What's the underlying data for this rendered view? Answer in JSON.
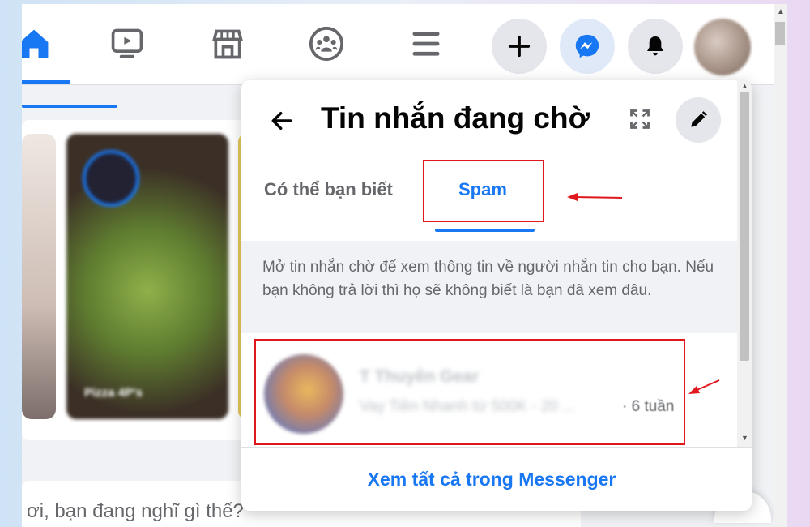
{
  "topbar": {
    "nav": [
      {
        "name": "home-icon",
        "active": true
      },
      {
        "name": "watch-icon"
      },
      {
        "name": "marketplace-icon"
      },
      {
        "name": "groups-icon"
      },
      {
        "name": "menu-icon"
      }
    ],
    "actions": [
      "create-icon",
      "messenger-icon",
      "notifications-icon",
      "profile-avatar"
    ]
  },
  "feed": {
    "story_caption": "Pizza 4P's",
    "composer_placeholder": "ơi, bạn đang nghĩ gì thế?"
  },
  "panel": {
    "title": "Tin nhắn đang chờ",
    "tabs": [
      {
        "label": "Có thể bạn biết",
        "active": false
      },
      {
        "label": "Spam",
        "active": true
      }
    ],
    "info_text": "Mở tin nhắn chờ để xem thông tin về người nhắn tin cho bạn. Nếu bạn không trả lời thì họ sẽ không biết là bạn đã xem đâu.",
    "message": {
      "name": "T Thuyên Gear",
      "preview": "Vay Tiền Nhanh từ 500K - 20 ...",
      "time": "· 6 tuần"
    },
    "footer_link": "Xem tất cả trong Messenger"
  },
  "colors": {
    "accent": "#1877f2",
    "annotation": "#e1171e",
    "panel_bg": "#ffffff",
    "feed_bg": "#f0f2f5"
  }
}
